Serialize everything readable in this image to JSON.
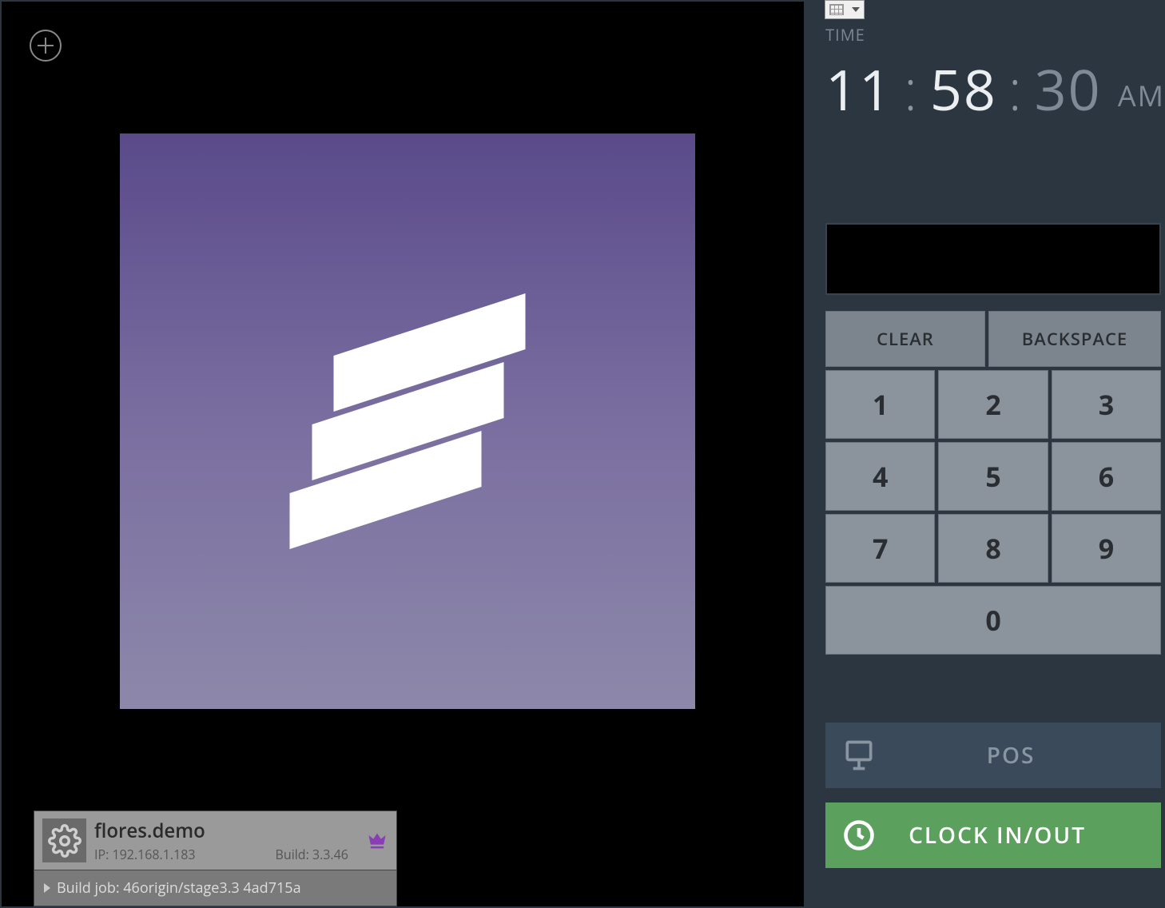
{
  "time": {
    "label": "TIME",
    "hours": "11",
    "minutes": "58",
    "seconds": "30",
    "ampm": "AM"
  },
  "keypad": {
    "clear": "CLEAR",
    "backspace": "BACKSPACE",
    "keys": [
      "1",
      "2",
      "3",
      "4",
      "5",
      "6",
      "7",
      "8",
      "9",
      "0"
    ]
  },
  "actions": {
    "pos": "POS",
    "clock": "CLOCK IN/OUT"
  },
  "server": {
    "name": "flores.demo",
    "ip_label": "IP:",
    "ip": "192.168.1.183",
    "build_label": "Build:",
    "build": "3.3.46",
    "job_prefix": "Build job:",
    "job": "46origin/stage3.3 4ad715a"
  }
}
